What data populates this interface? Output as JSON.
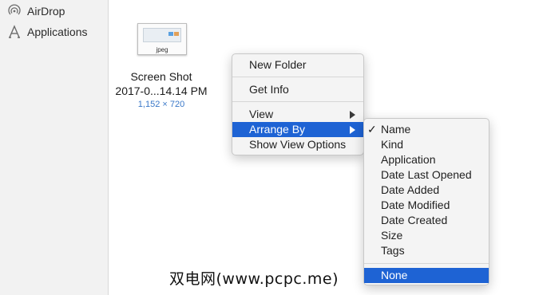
{
  "sidebar": {
    "items": [
      {
        "label": "AirDrop",
        "icon": "airdrop-icon"
      },
      {
        "label": "Applications",
        "icon": "applications-icon"
      }
    ]
  },
  "file": {
    "extension": "jpeg",
    "name_line1": "Screen Shot",
    "name_line2": "2017-0...14.14 PM",
    "dimensions": "1,152 × 720"
  },
  "context_menu": {
    "items": [
      {
        "label": "New Folder"
      },
      {
        "label": "Get Info"
      },
      {
        "label": "View",
        "has_submenu": true
      },
      {
        "label": "Arrange By",
        "has_submenu": true,
        "highlighted": true
      },
      {
        "label": "Show View Options"
      }
    ]
  },
  "arrange_submenu": {
    "checkmark": "✓",
    "items": [
      {
        "label": "Name",
        "checked": true
      },
      {
        "label": "Kind"
      },
      {
        "label": "Application"
      },
      {
        "label": "Date Last Opened"
      },
      {
        "label": "Date Added"
      },
      {
        "label": "Date Modified"
      },
      {
        "label": "Date Created"
      },
      {
        "label": "Size"
      },
      {
        "label": "Tags"
      },
      {
        "label": "None",
        "highlighted": true
      }
    ]
  },
  "watermark": {
    "text": "双电网(www.pcpc.me)"
  },
  "colors": {
    "highlight": "#1e63d4",
    "sidebar_bg": "#f2f2f2",
    "dimension_text": "#3a78c8"
  }
}
